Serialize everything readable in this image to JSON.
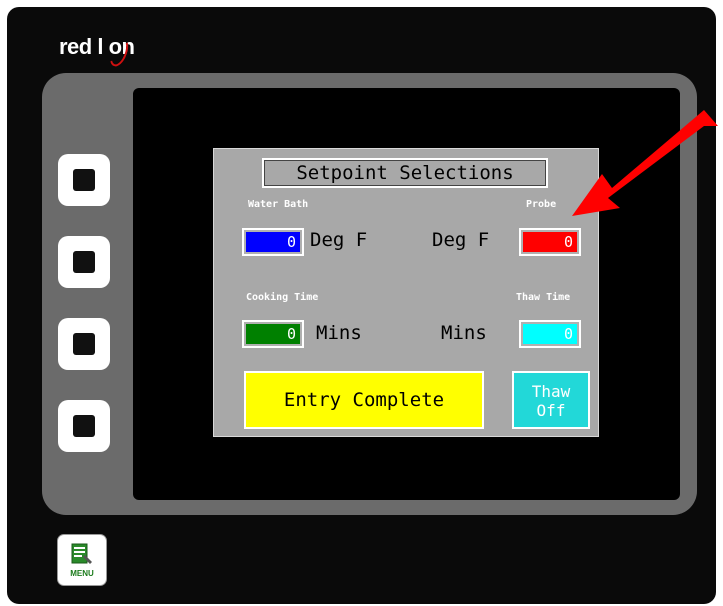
{
  "brand": {
    "logo_text": "red lion"
  },
  "panel": {
    "title": "Setpoint Selections",
    "water_bath": {
      "label": "Water Bath",
      "value": "0",
      "unit": "Deg F",
      "color": "#0000ff"
    },
    "probe": {
      "label": "Probe",
      "value": "0",
      "unit": "Deg F",
      "color": "#ff0000"
    },
    "cooking_time": {
      "label": "Cooking Time",
      "value": "0",
      "unit": "Mins",
      "color": "#008000"
    },
    "thaw_time": {
      "label": "Thaw Time",
      "value": "0",
      "unit": "Mins",
      "color": "#00ffff"
    },
    "entry_button": {
      "label": "Entry Complete",
      "color": "#ffff00"
    },
    "thaw_button": {
      "line1": "Thaw",
      "line2": "Off",
      "color": "#22d8d8"
    }
  },
  "menu_button": {
    "label": "MENU"
  },
  "annotation": {
    "arrow_color": "#ff0000",
    "points_to": "probe"
  }
}
